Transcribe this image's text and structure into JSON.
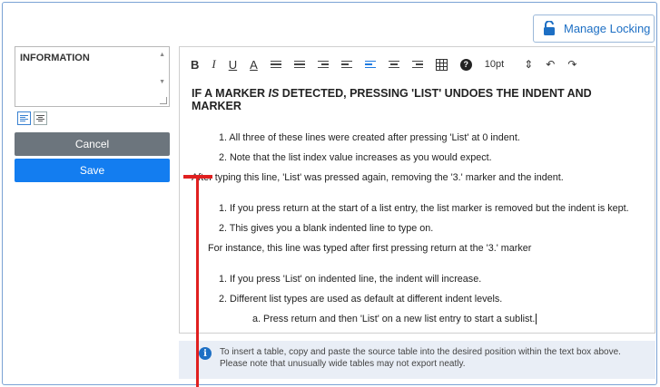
{
  "header": {
    "lock_label": "Manage Locking"
  },
  "sidebar": {
    "info_label": "INFORMATION",
    "cancel_label": "Cancel",
    "save_label": "Save"
  },
  "toolbar": {
    "bold": "B",
    "italic": "I",
    "underline": "U",
    "font_color": "A",
    "font_size": "10pt",
    "size_arrows": "⇕",
    "undo": "↶",
    "redo": "↷",
    "info_glyph": "?"
  },
  "editor": {
    "heading_pre": "IF A MARKER ",
    "heading_em": "IS",
    "heading_post": " DETECTED, PRESSING 'LIST' UNDOES THE INDENT AND MARKER",
    "lines": [
      "1. All three of these lines were created after pressing 'List' at 0 indent.",
      "2. Note that the list index value increases as you would expect.",
      "After typing this line, 'List' was pressed again, removing the '3.' marker and the indent.",
      "1. If you press return at the start of a list entry, the list marker is removed but the indent is kept.",
      "2. This gives you a blank indented line to type on.",
      "For instance, this line was typed after first pressing return at the '3.' marker",
      "1. If you press 'List' on indented line, the indent will increase.",
      "2. Different list types are used as default at different indent levels.",
      "a. Press return and then 'List' on a new list entry to start a sublist."
    ]
  },
  "note": {
    "line1": "To insert a table, copy and paste the source table into the desired position within the text box above.",
    "line2": "Please note that unusually wide tables may not export neatly."
  },
  "colors": {
    "accent": "#137df0",
    "marker": "#e02020",
    "cancel": "#6c757d"
  }
}
